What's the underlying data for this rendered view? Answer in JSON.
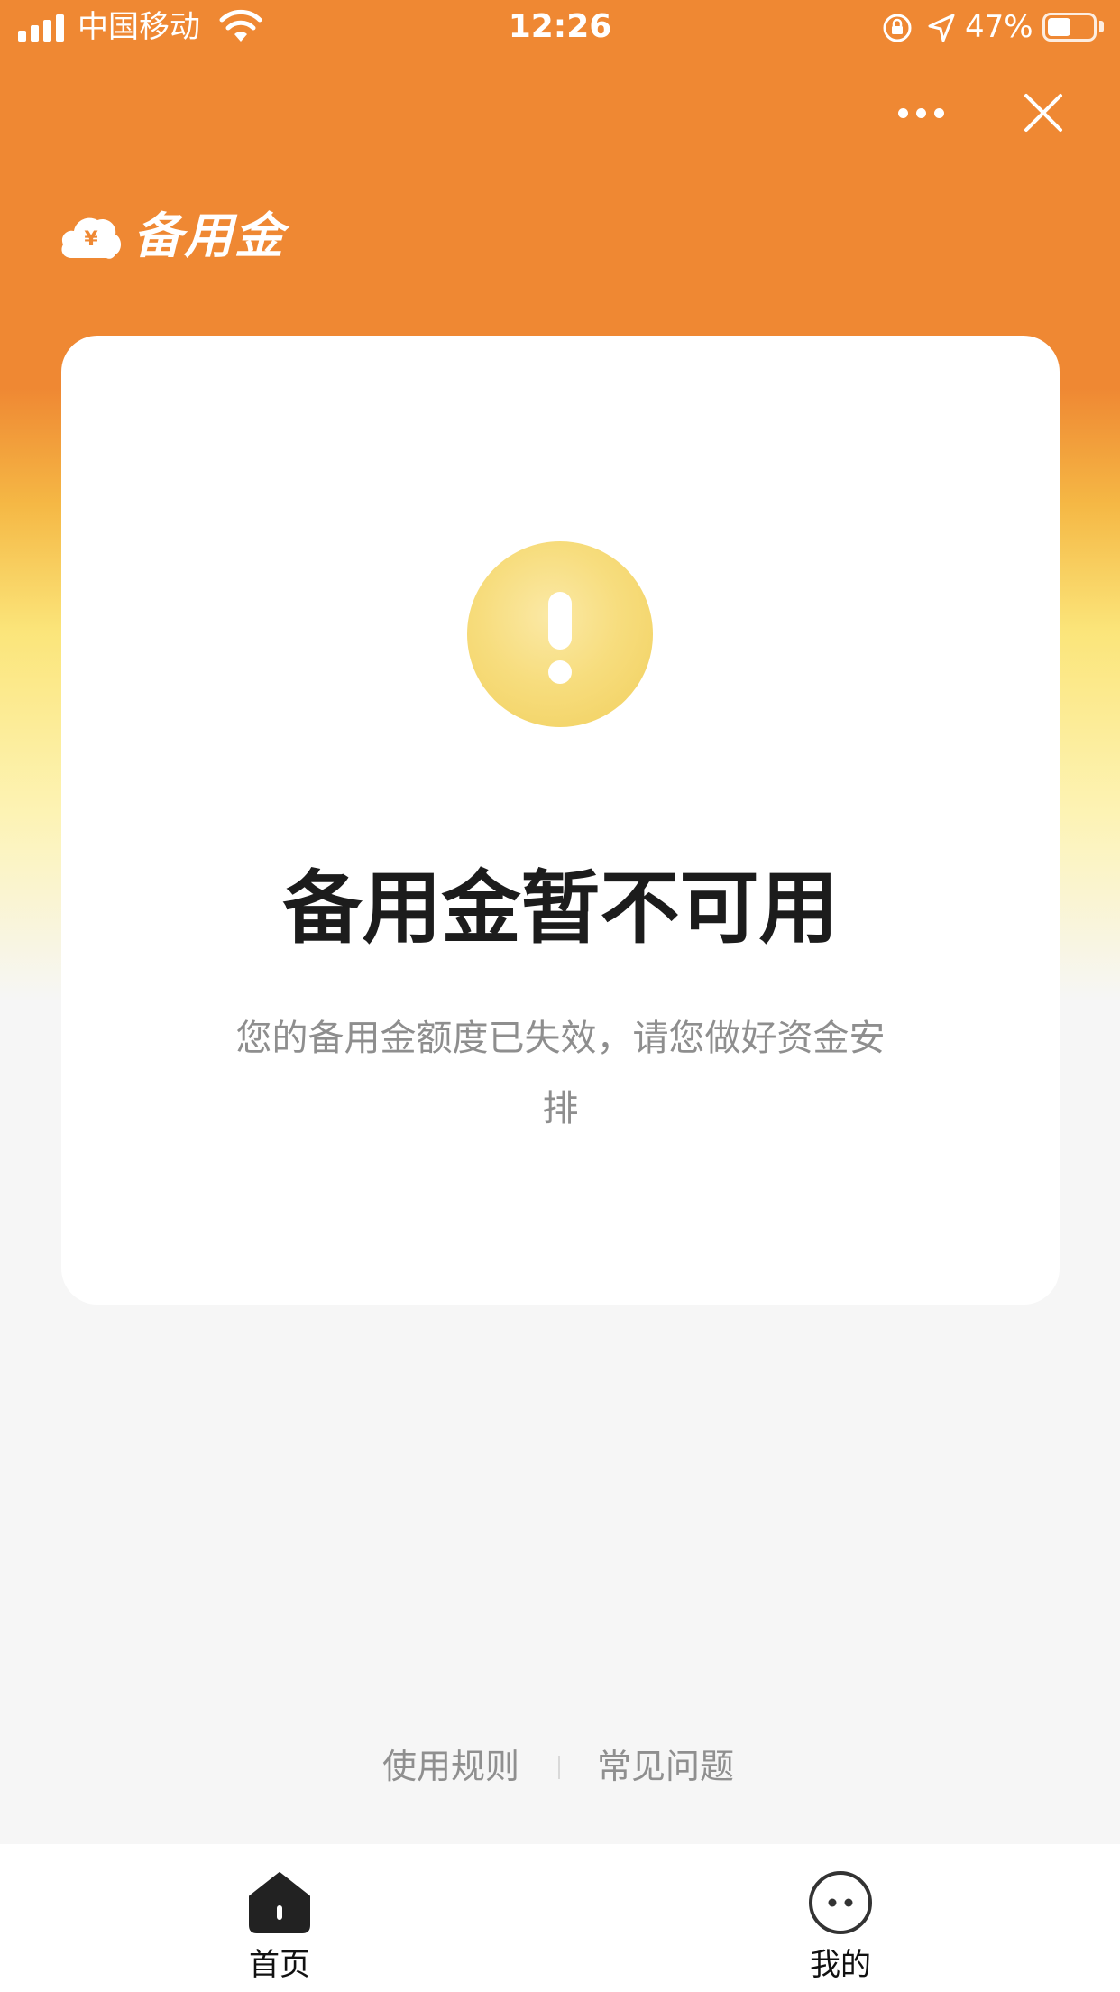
{
  "status_bar": {
    "carrier": "中国移动",
    "time": "12:26",
    "battery": "47%",
    "battery_level": 0.47,
    "icons": [
      "signal-icon",
      "wifi-icon",
      "orientation-lock-icon",
      "location-icon",
      "battery-icon"
    ]
  },
  "nav": {
    "more_icon": "more-dots-icon",
    "close_icon": "close-icon"
  },
  "brand": {
    "title": "备用金",
    "icon": "coin-cloud-icon"
  },
  "card": {
    "icon": "warning-icon",
    "title": "备用金暂不可用",
    "description": "您的备用金额度已失效，请您做好资金安排"
  },
  "footer_links": [
    {
      "label": "使用规则"
    },
    {
      "label": "常见问题"
    }
  ],
  "tabs": [
    {
      "label": "首页",
      "icon": "home-icon",
      "active": true
    },
    {
      "label": "我的",
      "icon": "profile-icon",
      "active": false
    }
  ],
  "colors": {
    "header_orange": "#ef8833",
    "warning_yellow": "#f4d66e",
    "title_text": "#1c1c1c",
    "muted_text": "#8e8e8e"
  }
}
